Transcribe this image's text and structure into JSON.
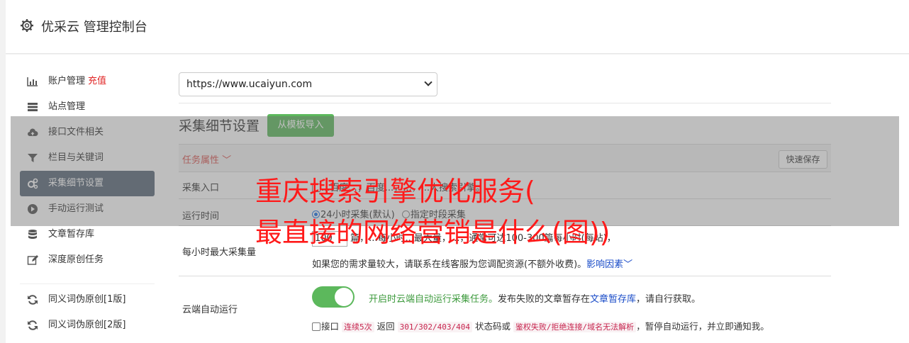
{
  "header": {
    "title": "优采云 管理控制台",
    "icon": "gear-icon"
  },
  "sidebar": {
    "items": [
      {
        "label": "账户管理",
        "extra": "充值",
        "icon": "bar-chart-icon"
      },
      {
        "label": "站点管理",
        "icon": "server-icon"
      },
      {
        "label": "接口文件相关",
        "icon": "cloud-upload-icon"
      },
      {
        "label": "栏目与关键词",
        "icon": "filter-icon"
      },
      {
        "label": "采集细节设置",
        "icon": "cogs-icon",
        "active": true
      },
      {
        "label": "手动运行测试",
        "icon": "play-circle-icon"
      },
      {
        "label": "文章暂存库",
        "icon": "database-icon"
      },
      {
        "label": "深度原创任务",
        "icon": "edit-icon"
      },
      {
        "label": "同义词伪原创[1版]",
        "icon": "refresh-icon"
      },
      {
        "label": "同义词伪原创[2版]",
        "icon": "refresh-icon"
      }
    ]
  },
  "main": {
    "site_select": {
      "value": "https://www.ucaiyun.com"
    },
    "section_title": "采集细节设置",
    "template_button": "从模板导入",
    "table": {
      "header_label": "任务属性",
      "save_button": "快速保存",
      "rows": {
        "entry": {
          "label": "采集入口",
          "value": "...百度...；百度...，...，...大搜索引擎。"
        },
        "runtime": {
          "label": "运行时间",
          "opt1": "24小时采集(默认)",
          "opt2": "指定时段采集"
        },
        "maxcount": {
          "label": "每小时最大采集量",
          "input": "100",
          "line1_a": "篇，...每小时...最大量，...，通常可达100-300篇每小时(每站)，",
          "line2": "如果您的需求量较大，请联系在线客服为您调配资源(不额外收费)。",
          "link": "影响因素"
        },
        "cloud": {
          "label": "云端自动运行",
          "toggle_on": true,
          "desc_green": "开启时云端自动运行采集任务。",
          "desc": "发布失败的文章暂存在",
          "desc_link": "文章暂存库",
          "desc_end": "，请自行获取。",
          "chk_label": "接口",
          "code1": "连续5次",
          "mid1": "返回",
          "code2": "301/302/403/404",
          "mid2": "状态码或",
          "code3": "鉴权失败/拒绝连接/域名无法解析",
          "end": "，暂停自动运行，并立即通知我。"
        }
      }
    }
  },
  "overlay_headline": {
    "line1": "重庆搜索引擎优化服务(",
    "line2": "最直接的网络营销是什么(图))"
  },
  "colors": {
    "accent_green": "#5cb85c",
    "active_sidebar": "#5a6879",
    "headline_red": "#ff1a1a"
  }
}
